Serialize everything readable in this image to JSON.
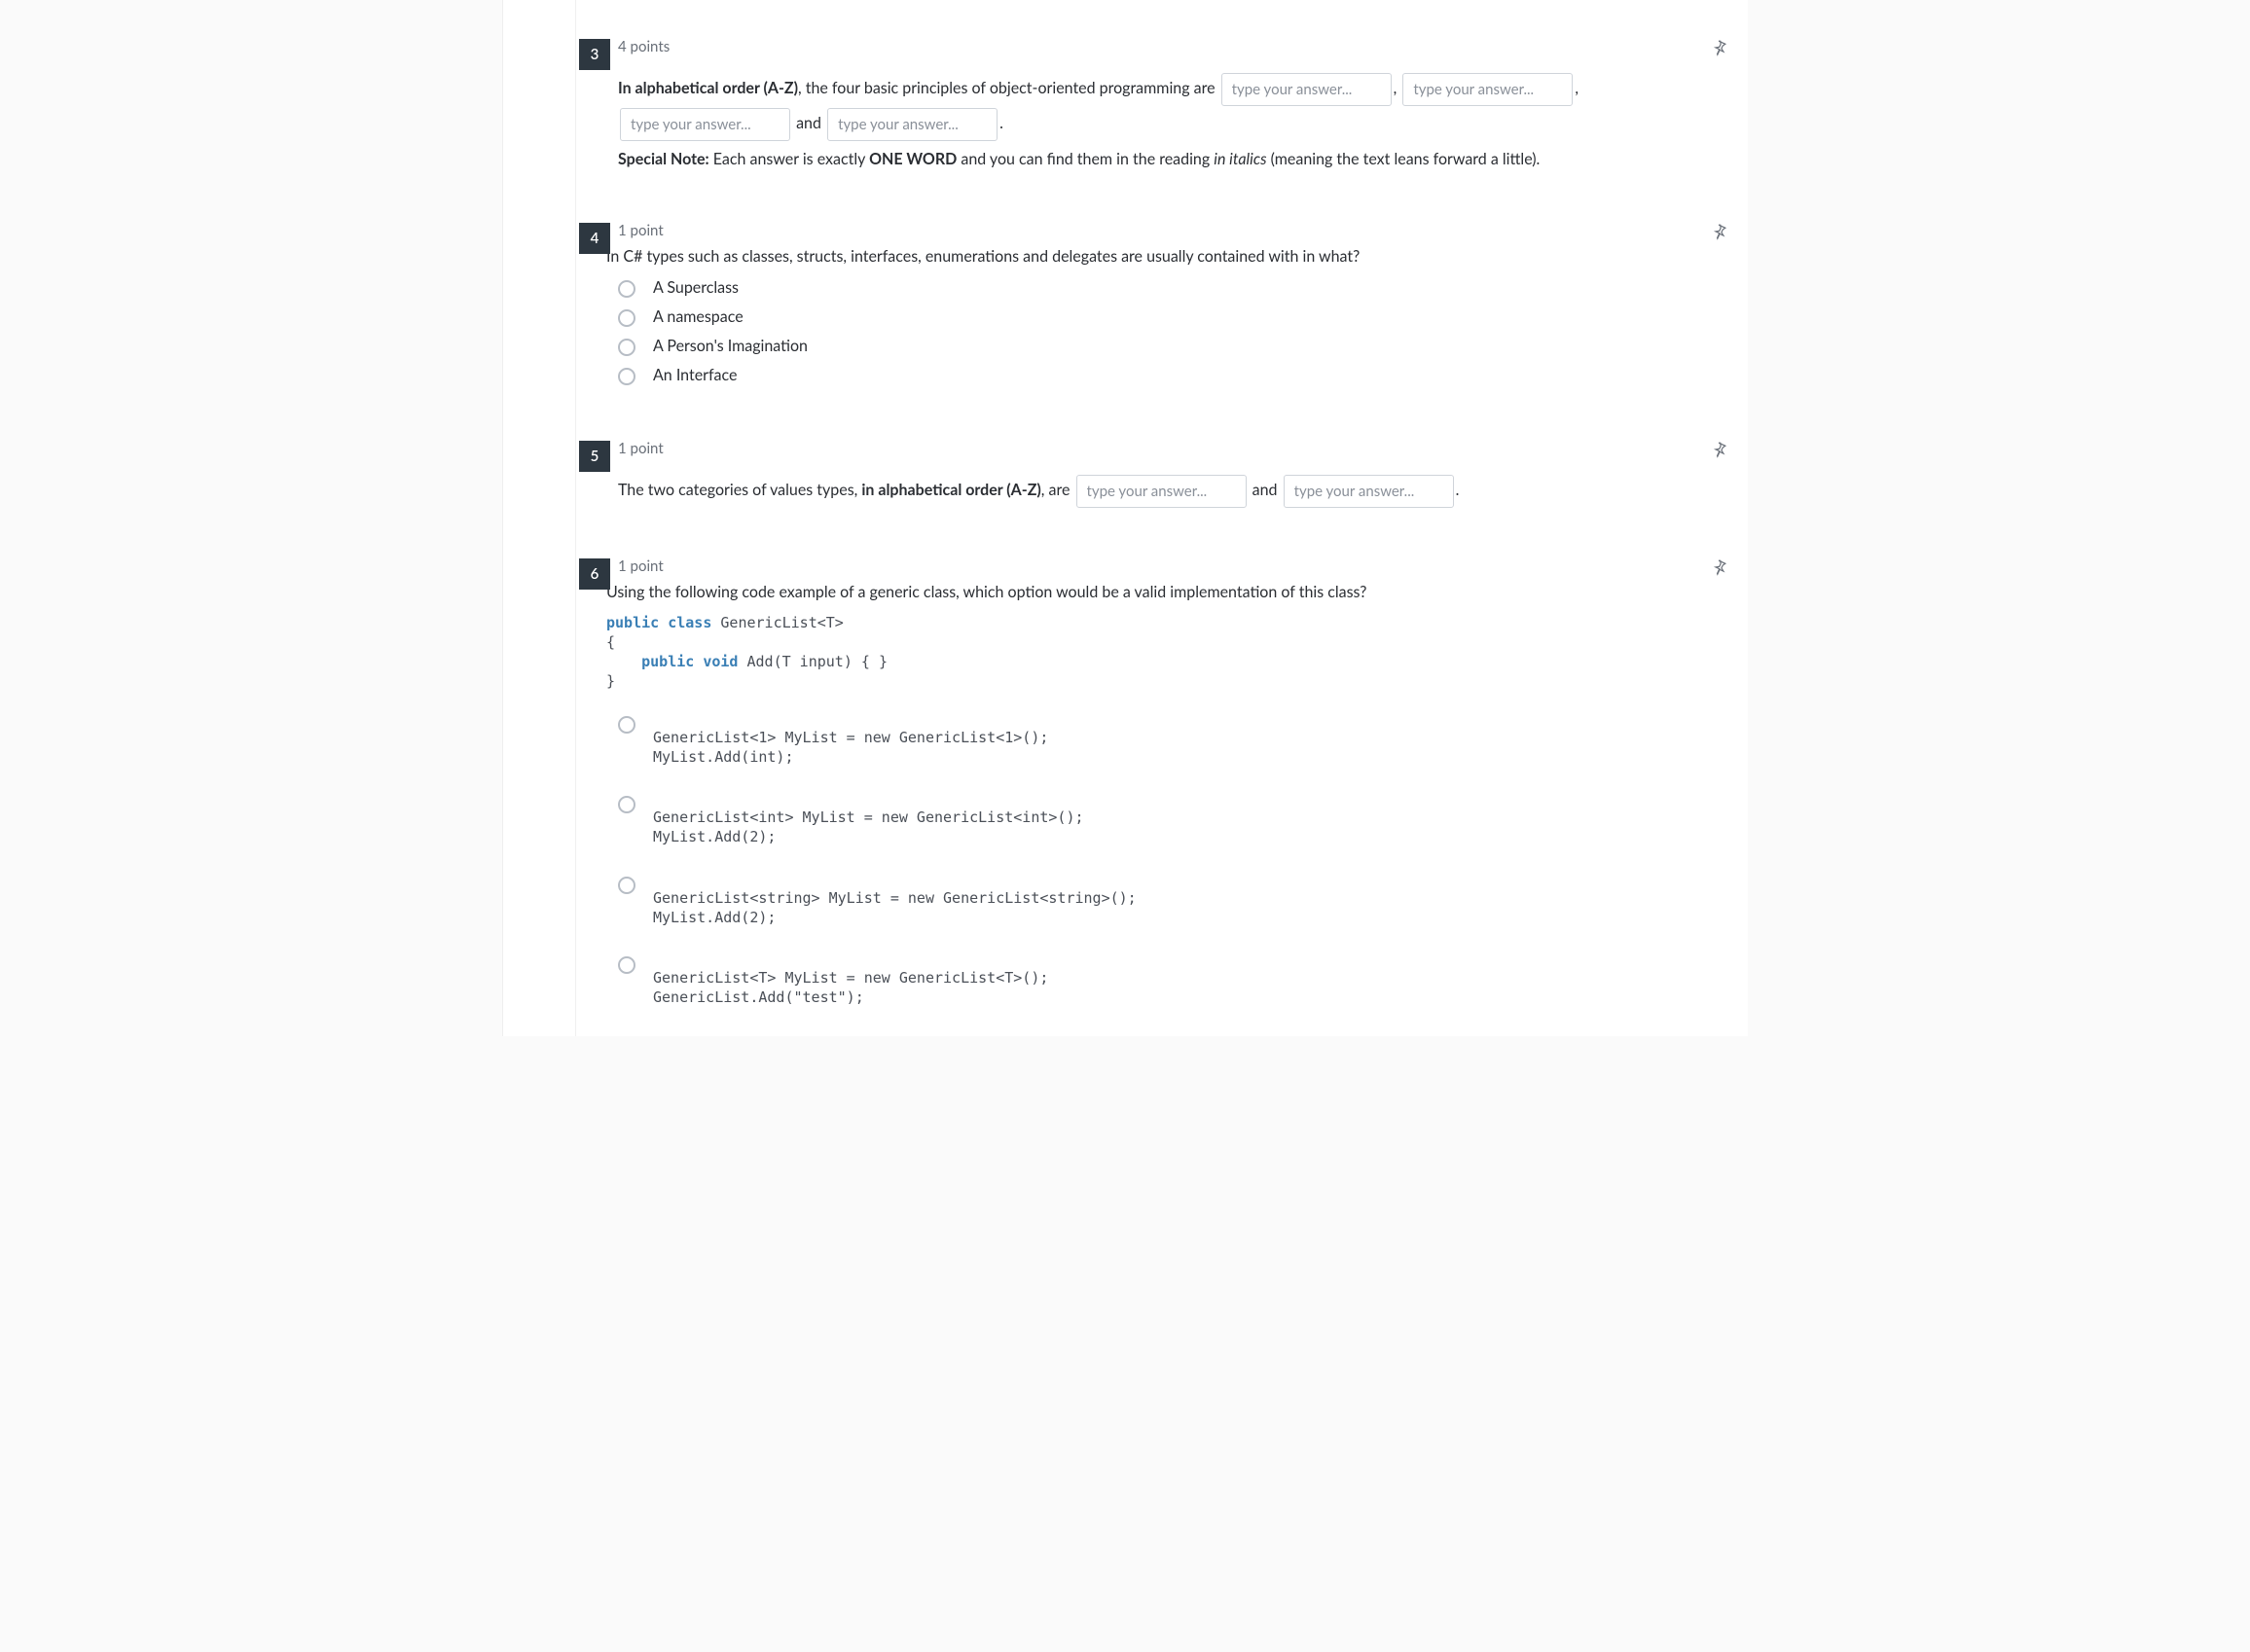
{
  "placeholder": "type your answer...",
  "q3": {
    "number": "3",
    "points": "4 points",
    "lead": "In alphabetical order (A-Z)",
    "mid": ", the four basic principles of object-oriented programming are",
    "comma": ",",
    "and": "and",
    "period": ".",
    "note_lead": "Special Note:",
    "note_text1": " Each answer is exactly ",
    "note_oneword": "ONE WORD",
    "note_text2": " and you can find them in the reading ",
    "note_italics": "in italics",
    "note_text3": " (meaning the text leans forward a little)."
  },
  "q4": {
    "number": "4",
    "points": "1 point",
    "text": "In C# types such as classes, structs, interfaces, enumerations and delegates are usually contained with in what?",
    "choices": [
      "A Superclass",
      "A namespace",
      "A Person's Imagination",
      "An Interface"
    ]
  },
  "q5": {
    "number": "5",
    "points": "1 point",
    "pre": "The two categories of values types, ",
    "bold": "in alphabetical order (A-Z)",
    "post": ", are",
    "and": "and",
    "period": "."
  },
  "q6": {
    "number": "6",
    "points": "1 point",
    "text": "Using the following code example of a generic class, which option would be a valid implementation of this class?",
    "code_kw1": "public class",
    "code_l1": " GenericList<T>",
    "code_l2": "{",
    "code_kw2": "public void",
    "code_l3": " Add(T input) { }",
    "code_l4": "}",
    "choices": [
      "GenericList<1> MyList = new GenericList<1>();\nMyList.Add(int);",
      "GenericList<int> MyList = new GenericList<int>();\nMyList.Add(2);",
      "GenericList<string> MyList = new GenericList<string>();\nMyList.Add(2);",
      "GenericList<T> MyList = new GenericList<T>();\nGenericList.Add(\"test\");"
    ]
  }
}
